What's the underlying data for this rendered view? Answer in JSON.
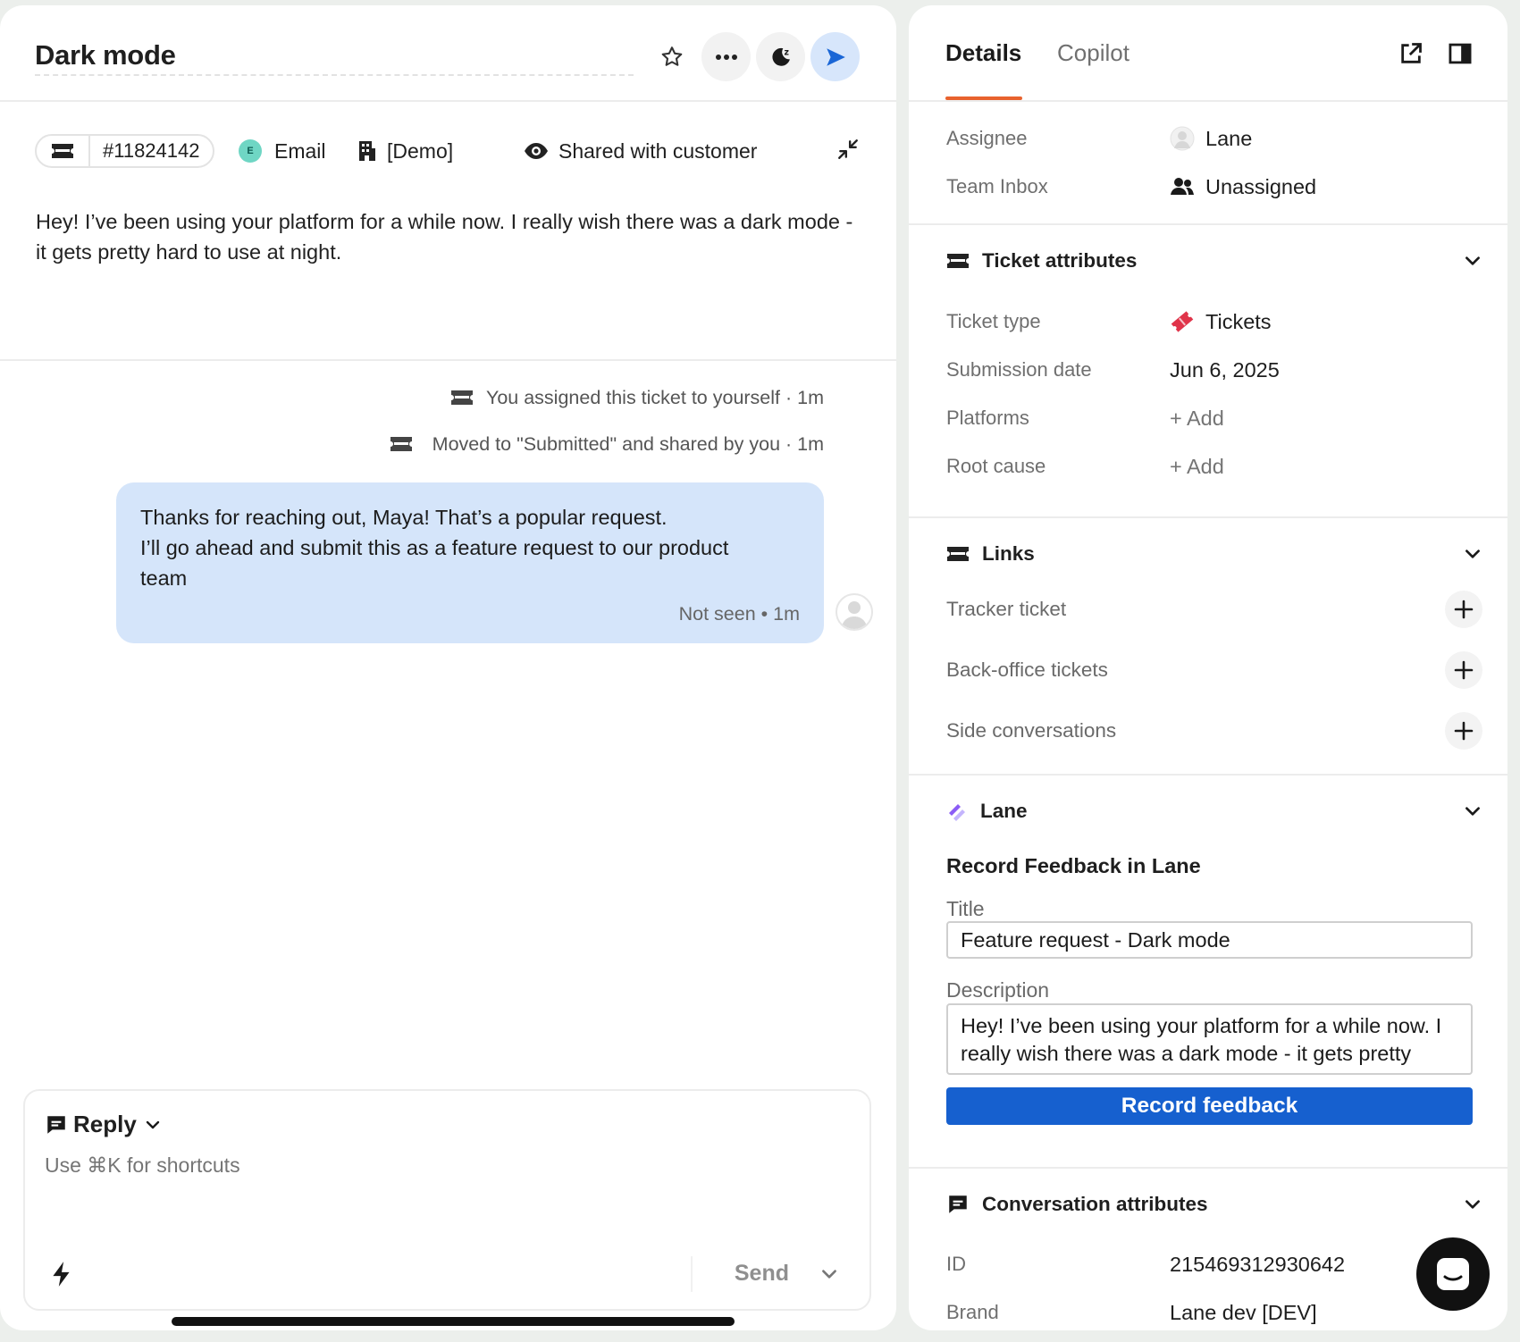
{
  "conversation": {
    "title": "Dark mode",
    "ticket_id": "#11824142",
    "channel": "Email",
    "channel_initial": "E",
    "company": "[Demo]",
    "visibility": "Shared with customer",
    "customer_message": "Hey! I’ve been using your platform for a while now. I really wish there was a dark mode - it gets pretty hard to use at night.",
    "events": [
      "You assigned this ticket to yourself · 1m",
      "Moved to \"Submitted\" and shared by you · 1m"
    ],
    "reply_bubble": {
      "lines": [
        "Thanks for reaching out, Maya! That’s a popular request.",
        "I’ll go ahead and submit this as a feature request to our product",
        "team"
      ],
      "status": "Not seen • 1m"
    }
  },
  "composer": {
    "mode": "Reply",
    "placeholder": "Use ⌘K for shortcuts",
    "send_label": "Send"
  },
  "sidebar": {
    "tabs": [
      "Details",
      "Copilot"
    ],
    "assignee_label": "Assignee",
    "assignee_value": "Lane",
    "team_label": "Team Inbox",
    "team_value": "Unassigned",
    "ticket_attributes": {
      "heading": "Ticket attributes",
      "rows": [
        {
          "label": "Ticket type",
          "value": "Tickets"
        },
        {
          "label": "Submission date",
          "value": "Jun 6, 2025"
        },
        {
          "label": "Platforms",
          "value": "+ Add"
        },
        {
          "label": "Root cause",
          "value": "+ Add"
        }
      ]
    },
    "links": {
      "heading": "Links",
      "items": [
        "Tracker ticket",
        "Back-office tickets",
        "Side conversations"
      ]
    },
    "lane": {
      "heading": "Lane",
      "subtitle": "Record Feedback in Lane",
      "title_label": "Title",
      "title_value": "Feature request - Dark mode",
      "description_label": "Description",
      "description_value": "Hey! I’ve been using your platform for a while now. I really wish there was a dark mode - it gets pretty hard to use at night.",
      "button": "Record feedback"
    },
    "conversation_attributes": {
      "heading": "Conversation attributes",
      "rows": [
        {
          "label": "ID",
          "value": "215469312930642"
        },
        {
          "label": "Brand",
          "value": "Lane dev [DEV]"
        }
      ]
    }
  },
  "colors": {
    "accent_tab": "#e8622e",
    "primary_button": "#1660cf",
    "bubble": "#d5e5fa",
    "send_icon": "#1a66d6"
  }
}
